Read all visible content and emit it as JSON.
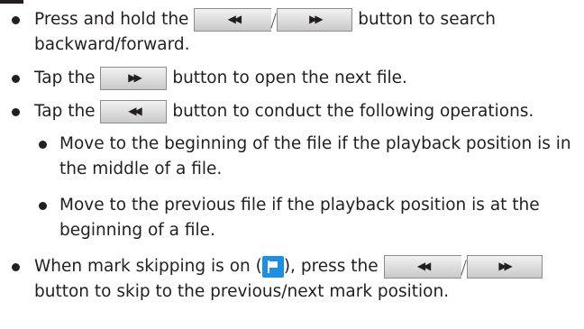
{
  "items": [
    {
      "before": "Press and hold the",
      "after": " button to search backward/forward.",
      "rewind_icon": "rewind-icon",
      "forward_icon": "fast-forward-icon"
    },
    {
      "before": "Tap the",
      "after": " button to open the next file.",
      "forward_icon": "fast-forward-icon"
    },
    {
      "before": "Tap the",
      "after": " button to conduct the following operations.",
      "rewind_icon": "rewind-icon",
      "subitems": [
        "Move to the beginning of the file if the playback position is in the middle of a file.",
        "Move to the previous file if the playback position is at the beginning of a file."
      ]
    },
    {
      "before": "When mark skipping is on (",
      "middle": "), press the",
      "after": " button to skip to the previous/next mark position.",
      "flag_icon": "mark-flag-icon",
      "rewind_icon": "rewind-icon",
      "forward_icon": "fast-forward-icon"
    }
  ],
  "colors": {
    "text": "#231f20",
    "flag": "#1b8fe3",
    "button_border": "#8c8c8c"
  }
}
